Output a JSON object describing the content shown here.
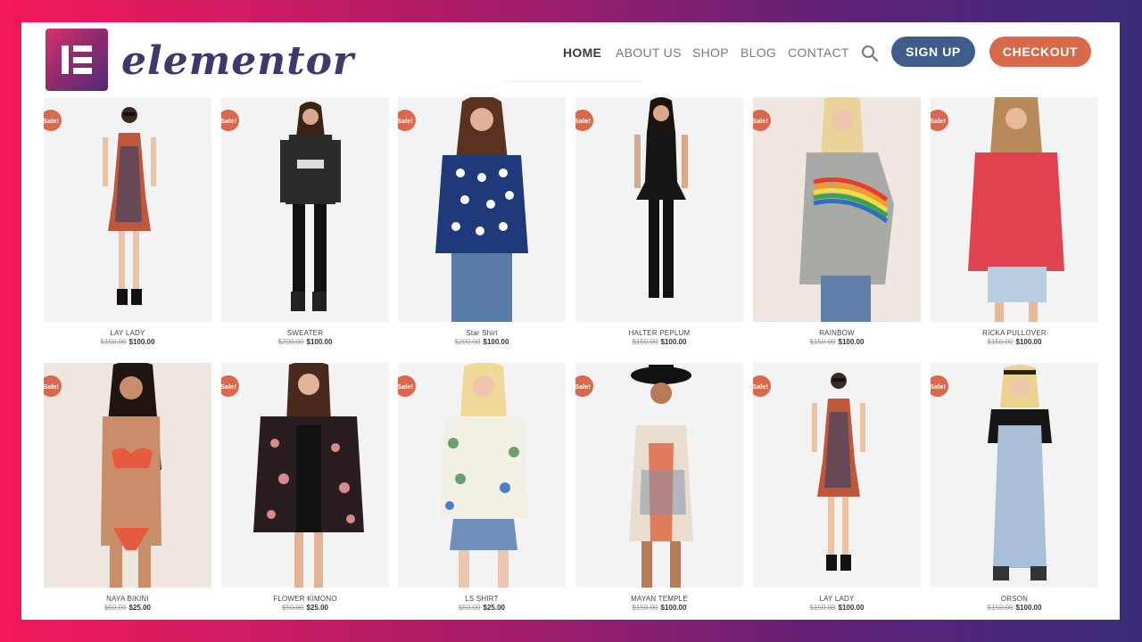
{
  "brand": {
    "name": "elementor",
    "logo_letter": "E"
  },
  "nav": {
    "items": [
      {
        "label": "HOME",
        "active": true
      },
      {
        "label": "ABOUT US",
        "active": false
      },
      {
        "label": "SHOP",
        "active": false
      },
      {
        "label": "BLOG",
        "active": false
      },
      {
        "label": "CONTACT",
        "active": false
      }
    ],
    "search_icon": "search-icon",
    "signup_label": "SIGN UP",
    "checkout_label": "CHECKOUT"
  },
  "colors": {
    "signup": "#3f5d8a",
    "checkout": "#d86a4c",
    "sale_badge": "#d8694c",
    "brand_text": "#3d3a6b"
  },
  "sale_badge": "Sale!",
  "products": [
    {
      "name": "LAY LADY",
      "old_price": "$150.00",
      "price": "$100.00"
    },
    {
      "name": "SWEATER",
      "old_price": "$200.00",
      "price": "$100.00"
    },
    {
      "name": "Star Shirt",
      "old_price": "$200.00",
      "price": "$100.00"
    },
    {
      "name": "HALTER PEPLUM",
      "old_price": "$150.00",
      "price": "$100.00"
    },
    {
      "name": "RAINBOW",
      "old_price": "$150.00",
      "price": "$100.00"
    },
    {
      "name": "RICKA PULLOVER",
      "old_price": "$150.00",
      "price": "$100.00"
    },
    {
      "name": "NAYA BIKINI",
      "old_price": "$50.00",
      "price": "$25.00"
    },
    {
      "name": "FLOWER KIMONO",
      "old_price": "$50.00",
      "price": "$25.00"
    },
    {
      "name": "LS SHIRT",
      "old_price": "$50.00",
      "price": "$25.00"
    },
    {
      "name": "MAYAN TEMPLE",
      "old_price": "$150.00",
      "price": "$100.00"
    },
    {
      "name": "LAY LADY",
      "old_price": "$150.00",
      "price": "$100.00"
    },
    {
      "name": "ORSON",
      "old_price": "$150.00",
      "price": "$100.00"
    }
  ]
}
